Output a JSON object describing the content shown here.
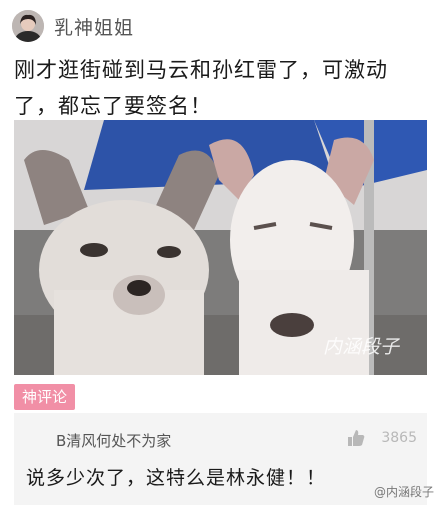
{
  "post": {
    "author": "乳神姐姐",
    "text": "刚才逛街碰到马云和孙红雷了，可激动了，都忘了要签名！",
    "image_alt_icon": "two-dogs-photo",
    "image_watermark": "内涵段子"
  },
  "section_tag": "神评论",
  "comment": {
    "author": "B清风何处不为家",
    "like_icon": "thumbs-up-icon",
    "likes": "3865",
    "text": "说多少次了，这特么是林永健！！"
  },
  "footer": {
    "watermark": "@内涵段子"
  },
  "colors": {
    "tag_bg": "#f18fa6",
    "comment_bg": "#f4f4f4"
  }
}
